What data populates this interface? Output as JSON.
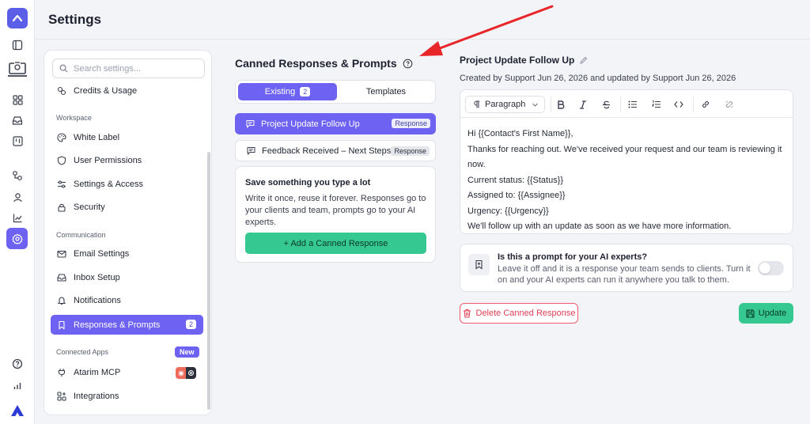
{
  "header": {
    "title": "Settings"
  },
  "rail": {
    "items": [
      "sidebar-toggle-icon",
      "desktop-sites-icon",
      "grid-icon",
      "inbox-icon",
      "board-icon",
      "integrations-flow-icon",
      "user-icon",
      "chart-icon",
      "settings-gear-icon",
      "help-icon",
      "stats-icon"
    ],
    "active": "settings-gear-icon"
  },
  "nav": {
    "search_placeholder": "Search settings...",
    "credits": "Credits & Usage",
    "workspace_label": "Workspace",
    "white_label": "White Label",
    "user_permissions": "User Permissions",
    "settings_access": "Settings & Access",
    "security": "Security",
    "communication_label": "Communication",
    "email_settings": "Email Settings",
    "inbox_setup": "Inbox Setup",
    "notifications": "Notifications",
    "responses_prompts": "Responses & Prompts",
    "responses_count": "2",
    "connected_apps_label": "Connected Apps",
    "new_badge": "New",
    "atarim_mcp": "Atarim MCP",
    "integrations": "Integrations"
  },
  "middle": {
    "title": "Canned Responses & Prompts",
    "tab_existing": "Existing",
    "tab_existing_count": "2",
    "tab_templates": "Templates",
    "responses": [
      {
        "title": "Project Update Follow Up",
        "tag": "Response"
      },
      {
        "title": "Feedback Received – Next Steps",
        "tag": "Response"
      }
    ],
    "card_heading": "Save something you type a lot",
    "card_text": "Write it once, reuse it forever. Responses go to your clients and team, prompts go to your AI experts.",
    "add_button": "+ Add a Canned Response"
  },
  "editor": {
    "title": "Project Update Follow Up",
    "meta": "Created by Support Jun 26, 2026 and updated by Support Jun 26, 2026",
    "paragraph_select": "Paragraph",
    "greeting": "Hi {{Contact's First Name}},",
    "line1": "Thanks for reaching out. We've received your request and our team is reviewing it now.",
    "status": "Current status: {{Status}}",
    "assigned": "Assigned to: {{Assignee}}",
    "urgency": "Urgency: {{Urgency}}",
    "closing": "We'll follow up with an update as soon as we have more information."
  },
  "prompt_toggle": {
    "question": "Is this a prompt for your AI experts?",
    "description": "Leave it off and it is a response your team sends to clients. Turn it on and your AI experts can run it anywhere you talk to them.",
    "enabled": false
  },
  "actions": {
    "delete": "Delete Canned Response",
    "update": "Update"
  },
  "colors": {
    "accent": "#6e62f3",
    "green": "#36c891",
    "danger": "#ef5b6e",
    "annotation_arrow": "#e8262a"
  }
}
